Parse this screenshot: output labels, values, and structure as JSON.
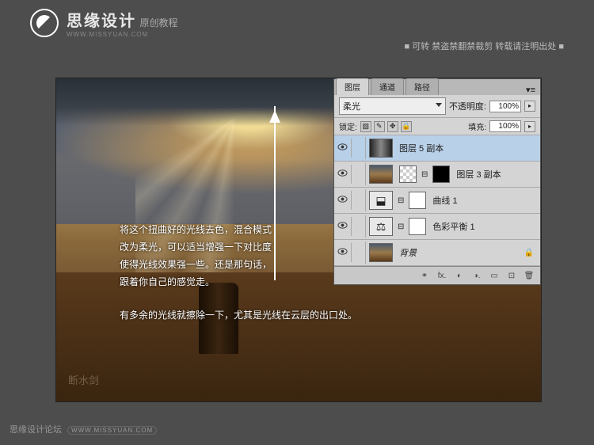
{
  "header": {
    "brand_title": "思缘设计",
    "brand_sub": "原创教程",
    "brand_url": "WWW.MISSYUAN.COM",
    "right_text": "■ 可转  禁盗禁翻禁裁剪   转载请注明出处 ■"
  },
  "canvas": {
    "text1_line1": "将这个扭曲好的光线去色，混合模式",
    "text1_line2": "改为柔光，可以适当增强一下对比度",
    "text1_line3": "使得光线效果强一些。还是那句话，",
    "text1_line4": "跟着你自己的感觉走。",
    "text2": "有多余的光线就擦除一下，尤其是光线在云层的出口处。",
    "watermark": "断水剑"
  },
  "panel": {
    "tabs": {
      "layers": "图层",
      "channels": "通道",
      "paths": "路径"
    },
    "blend_mode": "柔光",
    "opacity_label": "不透明度:",
    "opacity_value": "100%",
    "lock_label": "锁定:",
    "fill_label": "填充:",
    "fill_value": "100%",
    "layers": [
      {
        "name": "图层 5 副本"
      },
      {
        "name": "图层 3 副本"
      },
      {
        "name": "曲线 1"
      },
      {
        "name": "色彩平衡 1"
      },
      {
        "name": "背景"
      }
    ]
  },
  "footer": {
    "text": "思缘设计论坛",
    "url": "WWW.MISSYUAN.COM"
  }
}
